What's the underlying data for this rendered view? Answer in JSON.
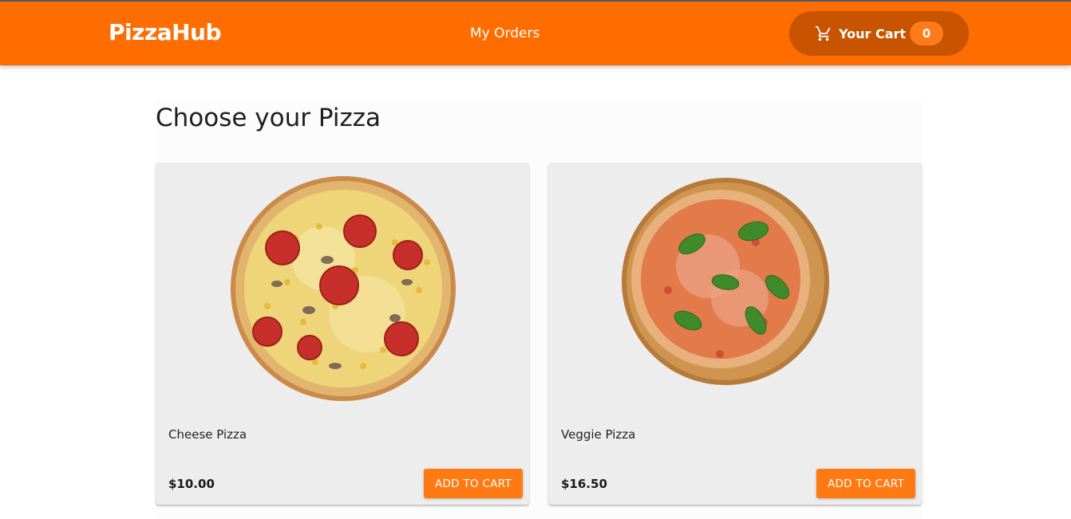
{
  "header": {
    "brand": "PizzaHub",
    "orders_link": "My Orders",
    "cart": {
      "label": "Your Cart",
      "count": "0",
      "icon": "cart-icon"
    }
  },
  "main": {
    "title": "Choose your Pizza",
    "products": [
      {
        "name": "Cheese Pizza",
        "price": "$10.00",
        "button": "ADD TO CART",
        "image": "cheese-pizza-image"
      },
      {
        "name": "Veggie Pizza",
        "price": "$16.50",
        "button": "ADD TO CART",
        "image": "veggie-pizza-image"
      }
    ]
  },
  "colors": {
    "brand": "#ff6d00",
    "cart_pill": "#c85300",
    "button": "#ff7a12",
    "card_bg": "#ededed"
  }
}
